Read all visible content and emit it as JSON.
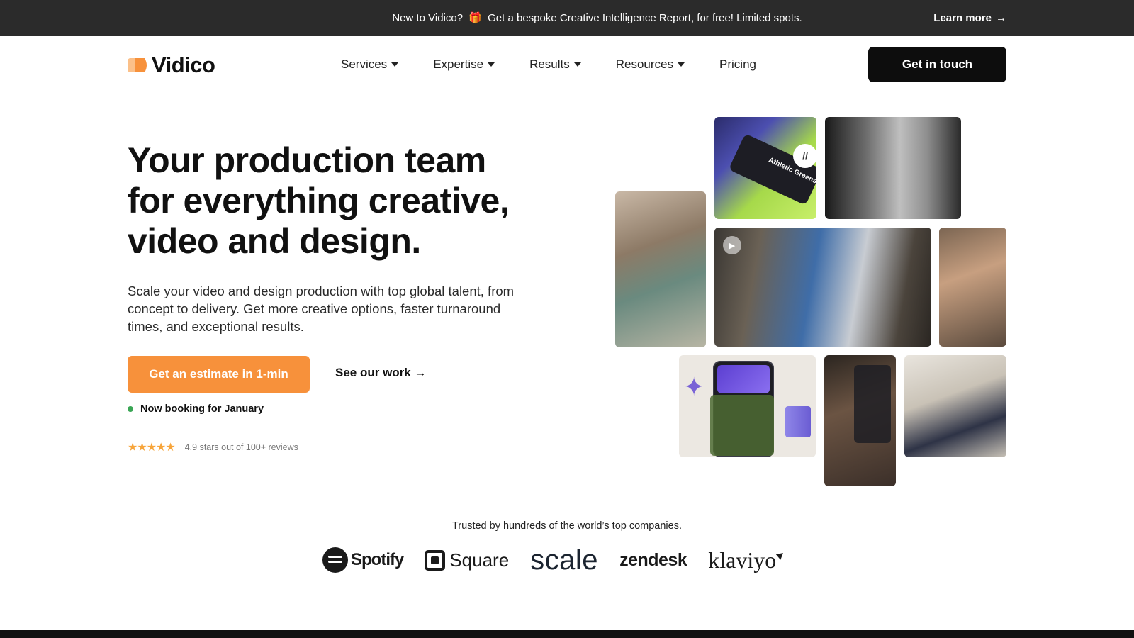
{
  "announcement": {
    "text_before": "New to Vidico?",
    "gift_icon": "🎁",
    "text_after": "Get a bespoke Creative Intelligence Report, for free! Limited spots.",
    "link_label": "Learn more",
    "link_arrow": "→"
  },
  "header": {
    "logo_text": "Vidico",
    "logo_colors": {
      "front": "#f7913b",
      "back": "#fbc089"
    },
    "nav": [
      {
        "label": "Services",
        "has_dropdown": true
      },
      {
        "label": "Expertise",
        "has_dropdown": true
      },
      {
        "label": "Results",
        "has_dropdown": true
      },
      {
        "label": "Resources",
        "has_dropdown": true
      },
      {
        "label": "Pricing",
        "has_dropdown": false
      }
    ],
    "cta_label": "Get in touch"
  },
  "hero": {
    "headline_lines": [
      "Your production team",
      "for everything creative,",
      "video and design."
    ],
    "subtext": "Scale your video and design production with top global talent, from concept to delivery. Get more creative options, faster turnaround times, and exceptional results.",
    "primary_cta": "Get an estimate in 1-min",
    "secondary_cta": "See our work →",
    "booking_status": "Now booking for January",
    "stars": "★★★★★",
    "rating_text": "4.9 stars out of 100+ reviews"
  },
  "collage": {
    "tiles": [
      {
        "name": "athletic-greens-video",
        "overlay_text": "Athletic Greens",
        "badge": "pause-icon"
      },
      {
        "name": "bw-portrait-video"
      },
      {
        "name": "payment-terminal-photo"
      },
      {
        "name": "cooking-shoot-video",
        "badge": "play-icon"
      },
      {
        "name": "chef-portrait-photo"
      },
      {
        "name": "music-app-ui"
      },
      {
        "name": "shopping-app-video"
      },
      {
        "name": "office-presenter-video"
      }
    ]
  },
  "trusted": {
    "title": "Trusted by hundreds of the world’s top companies.",
    "logos": [
      {
        "name": "spotify",
        "text": "Spotify"
      },
      {
        "name": "square",
        "text": "Square"
      },
      {
        "name": "scale",
        "text": "scale"
      },
      {
        "name": "zendesk",
        "text": "zendesk"
      },
      {
        "name": "klaviyo",
        "text": "klaviyo"
      }
    ]
  },
  "colors": {
    "announcement_bg": "#2b2b2b",
    "accent_orange": "#f7913b",
    "dark_button": "#0d0d0d",
    "booking_dot": "#3aa655",
    "star_color": "#f7a53b"
  }
}
